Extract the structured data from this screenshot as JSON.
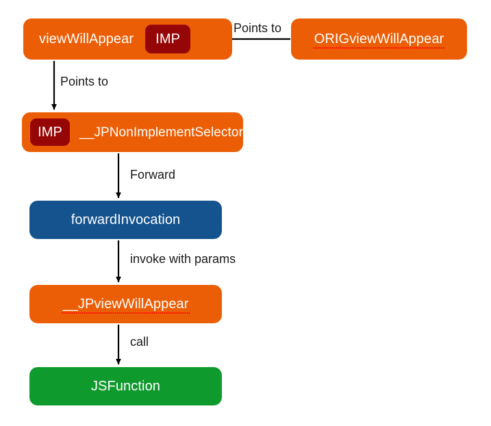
{
  "diagram": {
    "title": "JSPatch method swizzling flow",
    "background_color": "#ffffff",
    "colors": {
      "orange": "#EC5E05",
      "dark_red": "#970606",
      "blue": "#14538E",
      "green": "#0F9A2E",
      "arrow": "#000000",
      "label_text": "#1a1a1a",
      "node_text": "#ffffff",
      "misspell_underline": "#FF0000"
    },
    "nodes": [
      {
        "id": "viewWillAppear",
        "label": "viewWillAppear",
        "badge": "IMP",
        "badge_position": "right",
        "color": "orange"
      },
      {
        "id": "ORIGviewWillAppear",
        "label": "ORIGviewWillAppear",
        "color": "orange",
        "misspelled": true
      },
      {
        "id": "__JPNonImplementSelector",
        "label": "__JPNonImplementSelector",
        "badge": "IMP",
        "badge_position": "left",
        "color": "orange"
      },
      {
        "id": "forwardInvocation",
        "label": "forwardInvocation",
        "color": "blue"
      },
      {
        "id": "__JPviewWillAppear",
        "label": "__JPviewWillAppear",
        "color": "orange",
        "misspelled": true
      },
      {
        "id": "JSFunction",
        "label": "JSFunction",
        "color": "green"
      }
    ],
    "edges": [
      {
        "id": "orig-to-viewwillappear",
        "from": "ORIGviewWillAppear",
        "to": "viewWillAppear",
        "label": "Points to",
        "direction": "left"
      },
      {
        "id": "viewwillappear-to-nonimpl",
        "from": "viewWillAppear",
        "to": "__JPNonImplementSelector",
        "label": "Points to",
        "direction": "down"
      },
      {
        "id": "nonimpl-to-forward",
        "from": "__JPNonImplementSelector",
        "to": "forwardInvocation",
        "label": "Forward",
        "direction": "down"
      },
      {
        "id": "forward-to-jpview",
        "from": "forwardInvocation",
        "to": "__JPviewWillAppear",
        "label": "invoke with params",
        "direction": "down"
      },
      {
        "id": "jpview-to-jsfunction",
        "from": "__JPviewWillAppear",
        "to": "JSFunction",
        "label": "call",
        "direction": "down"
      }
    ]
  }
}
